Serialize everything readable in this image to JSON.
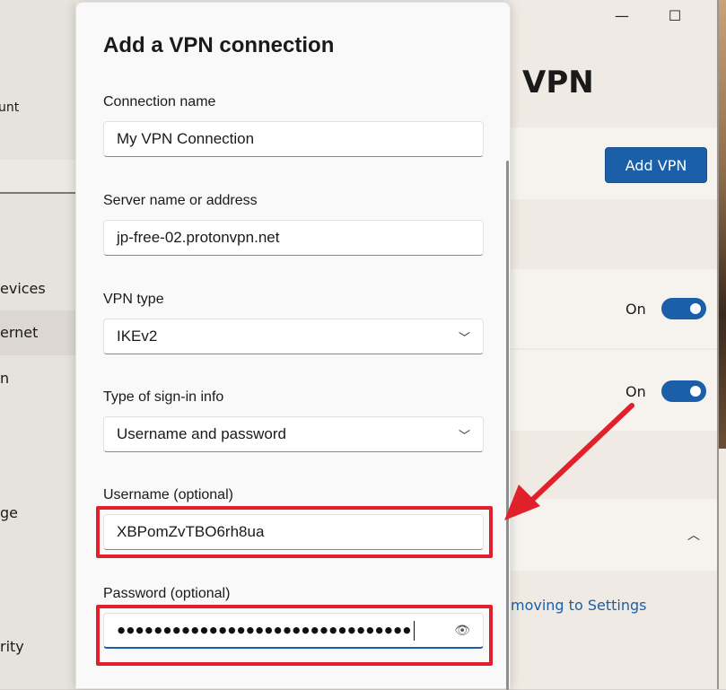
{
  "background_window": {
    "sidebar": {
      "account_label": "unt",
      "items": [
        {
          "label": "evices",
          "selected": false
        },
        {
          "label": "ernet",
          "selected": true
        },
        {
          "label": "n",
          "selected": false
        },
        {
          "label": "ge",
          "selected": false
        },
        {
          "label": "rity",
          "selected": false
        }
      ]
    },
    "page_title": "VPN",
    "add_vpn_label": "Add VPN",
    "toggles": [
      {
        "label": "On",
        "state": true
      },
      {
        "label": "On",
        "state": true
      }
    ],
    "link_text": "moving to Settings"
  },
  "dialog": {
    "title": "Add a VPN connection",
    "fields": {
      "connection_name": {
        "label": "Connection name",
        "value": "My VPN Connection"
      },
      "server": {
        "label": "Server name or address",
        "value": "jp-free-02.protonvpn.net"
      },
      "vpn_type": {
        "label": "VPN type",
        "value": "IKEv2"
      },
      "signin_type": {
        "label": "Type of sign-in info",
        "value": "Username and password"
      },
      "username": {
        "label": "Username (optional)",
        "value": "XBPomZvTBO6rh8ua"
      },
      "password": {
        "label": "Password (optional)",
        "value": "●●●●●●●●●●●●●●●●●●●●●●●●●●●●●●●●"
      }
    }
  },
  "colors": {
    "accent": "#1b5fa8",
    "highlight": "#e0212b"
  },
  "icons": {
    "minimize": "minimize-icon",
    "maximize": "maximize-icon",
    "dropdown": "chevron-down-icon",
    "reveal": "eye-icon"
  }
}
